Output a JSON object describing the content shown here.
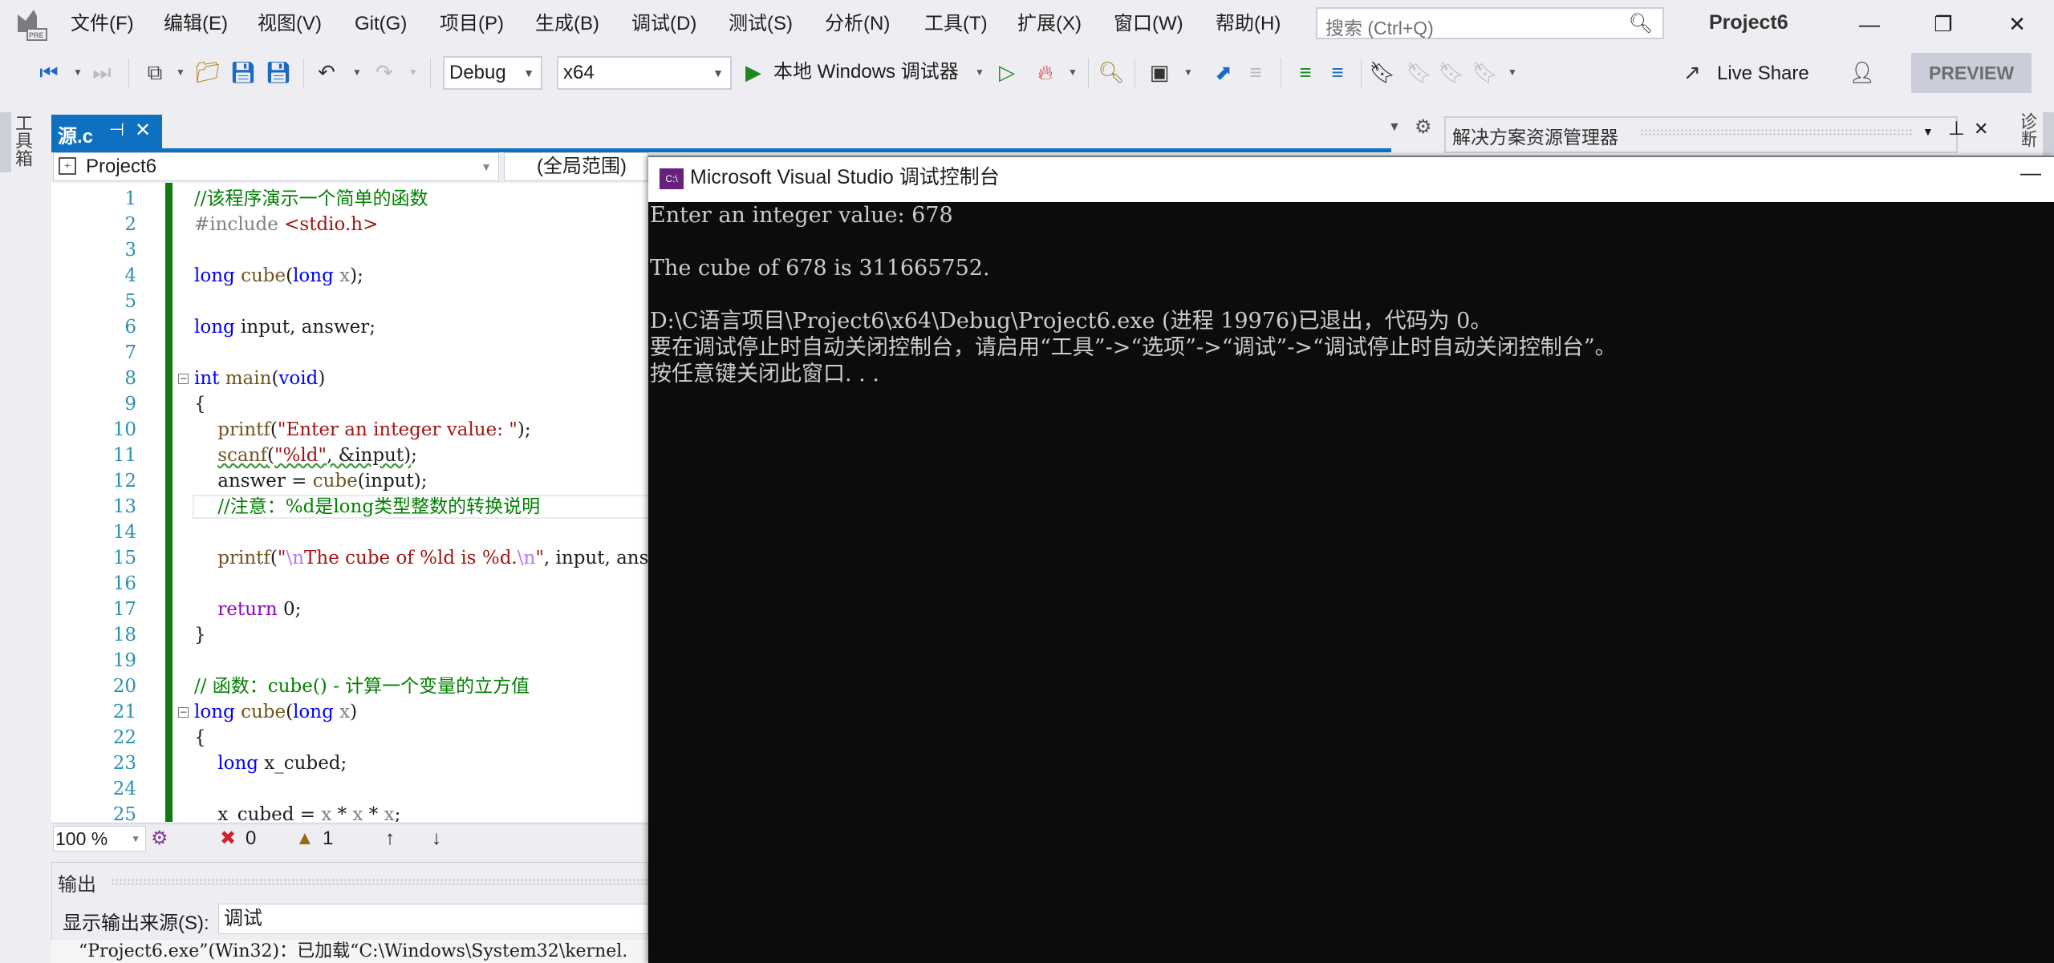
{
  "menubar": {
    "items": [
      "文件(F)",
      "编辑(E)",
      "视图(V)",
      "Git(G)",
      "项目(P)",
      "生成(B)",
      "调试(D)",
      "测试(S)",
      "分析(N)",
      "工具(T)",
      "扩展(X)",
      "窗口(W)",
      "帮助(H)"
    ],
    "search_placeholder": "搜索 (Ctrl+Q)",
    "project_title": "Project6"
  },
  "toolbar": {
    "configuration": "Debug",
    "platform": "x64",
    "run_label": "本地 Windows 调试器",
    "live_share": "Live Share",
    "preview": "PREVIEW"
  },
  "toolbox_label": "工具箱",
  "diagnostics_label": "诊断工具",
  "document_tab": {
    "name": "源.c",
    "pin": "⊣",
    "close": "✕"
  },
  "navbar": {
    "project": "Project6",
    "scope": "(全局范围)"
  },
  "editor": {
    "lines": [
      {
        "n": "1",
        "html": "<span class='cm'>//该程序演示一个简单的函数</span>"
      },
      {
        "n": "2",
        "html": "<span class='pp'>#include </span><span class='hdr'>&lt;stdio.h&gt;</span>"
      },
      {
        "n": "3",
        "html": ""
      },
      {
        "n": "4",
        "html": "<span class='kw'>long</span> <span class='fn'>cube</span>(<span class='kw'>long</span> <span class='par'>x</span>);"
      },
      {
        "n": "5",
        "html": ""
      },
      {
        "n": "6",
        "html": "<span class='kw'>long</span> input, answer;"
      },
      {
        "n": "7",
        "html": ""
      },
      {
        "n": "8",
        "html": "<span class='kw'>int</span> <span class='fn'>main</span>(<span class='kw'>void</span>)"
      },
      {
        "n": "9",
        "html": "{"
      },
      {
        "n": "10",
        "html": "    <span class='fn'>printf</span>(<span class='str'>\"Enter an integer value: \"</span>);"
      },
      {
        "n": "11",
        "html": "    <span class='squiggle'><span class='fn'>scanf</span>(<span class='str'>\"%ld\"</span>, &amp;input)</span>;"
      },
      {
        "n": "12",
        "html": "    answer = <span class='fn'>cube</span>(input);"
      },
      {
        "n": "13",
        "html": "    <span class='cm'>//注意：%d是long类型整数的转换说明</span>"
      },
      {
        "n": "14",
        "html": ""
      },
      {
        "n": "15",
        "html": "    <span class='fn'>printf</span>(<span class='str'>\"</span><span class='esc'>\\n</span><span class='str'>The cube of %ld is %d.</span><span class='esc'>\\n</span><span class='str'>\"</span>, input, answer);"
      },
      {
        "n": "16",
        "html": ""
      },
      {
        "n": "17",
        "html": "    <span class='ret'>return</span> 0;"
      },
      {
        "n": "18",
        "html": "}"
      },
      {
        "n": "19",
        "html": ""
      },
      {
        "n": "20",
        "html": "<span class='cm'>// 函数：cube() - 计算一个变量的立方值</span>"
      },
      {
        "n": "21",
        "html": "<span class='kw'>long</span> <span class='fn'>cube</span>(<span class='kw'>long</span> <span class='par'>x</span>)"
      },
      {
        "n": "22",
        "html": "{"
      },
      {
        "n": "23",
        "html": "    <span class='kw'>long</span> x_cubed;"
      },
      {
        "n": "24",
        "html": ""
      },
      {
        "n": "25",
        "html": "    x_cubed = <span class='par'>x</span> * <span class='par'>x</span> * <span class='par'>x</span>;"
      }
    ],
    "fold_lines": [
      8,
      21
    ]
  },
  "statusbar": {
    "zoom": "100 %",
    "errors": "0",
    "warnings": "1"
  },
  "output": {
    "title": "输出",
    "source_label": "显示输出来源(S):",
    "source_value": "调试",
    "text": "“Project6.exe”(Win32)：已加载“C:\\Windows\\System32\\kernel."
  },
  "solution_explorer": {
    "title": "解决方案资源管理器"
  },
  "console": {
    "title": "Microsoft Visual Studio 调试控制台",
    "lines": [
      "Enter an integer value: 678",
      "",
      "The cube of 678 is 311665752.",
      "",
      "D:\\C语言项目\\Project6\\x64\\Debug\\Project6.exe (进程 19976)已退出，代码为 0。",
      "要在调试停止时自动关闭控制台，请启用“工具”->“选项”->“调试”->“调试停止时自动关闭控制台”。",
      "按任意键关闭此窗口. . ."
    ]
  }
}
